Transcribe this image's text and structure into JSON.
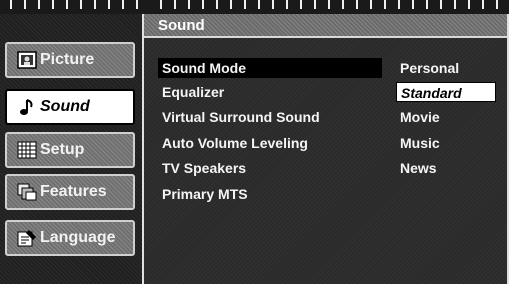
{
  "sidebar": {
    "items": [
      {
        "label": "Picture",
        "icon": "picture-icon",
        "active": false
      },
      {
        "label": "Sound",
        "icon": "music-note-icon",
        "active": true
      },
      {
        "label": "Setup",
        "icon": "grid-icon",
        "active": false
      },
      {
        "label": "Features",
        "icon": "features-icon",
        "active": false
      },
      {
        "label": "Language",
        "icon": "language-icon",
        "active": false
      }
    ]
  },
  "main": {
    "title": "Sound",
    "menu": [
      {
        "label": "Sound Mode",
        "selected": true
      },
      {
        "label": "Equalizer",
        "selected": false
      },
      {
        "label": "Virtual Surround Sound",
        "selected": false
      },
      {
        "label": "Auto Volume Leveling",
        "selected": false
      },
      {
        "label": "TV Speakers",
        "selected": false
      },
      {
        "label": "Primary MTS",
        "selected": false
      }
    ],
    "options": [
      {
        "label": "Personal",
        "selected": false
      },
      {
        "label": "Standard",
        "selected": true
      },
      {
        "label": "Movie",
        "selected": false
      },
      {
        "label": "Music",
        "selected": false
      },
      {
        "label": "News",
        "selected": false
      }
    ]
  }
}
